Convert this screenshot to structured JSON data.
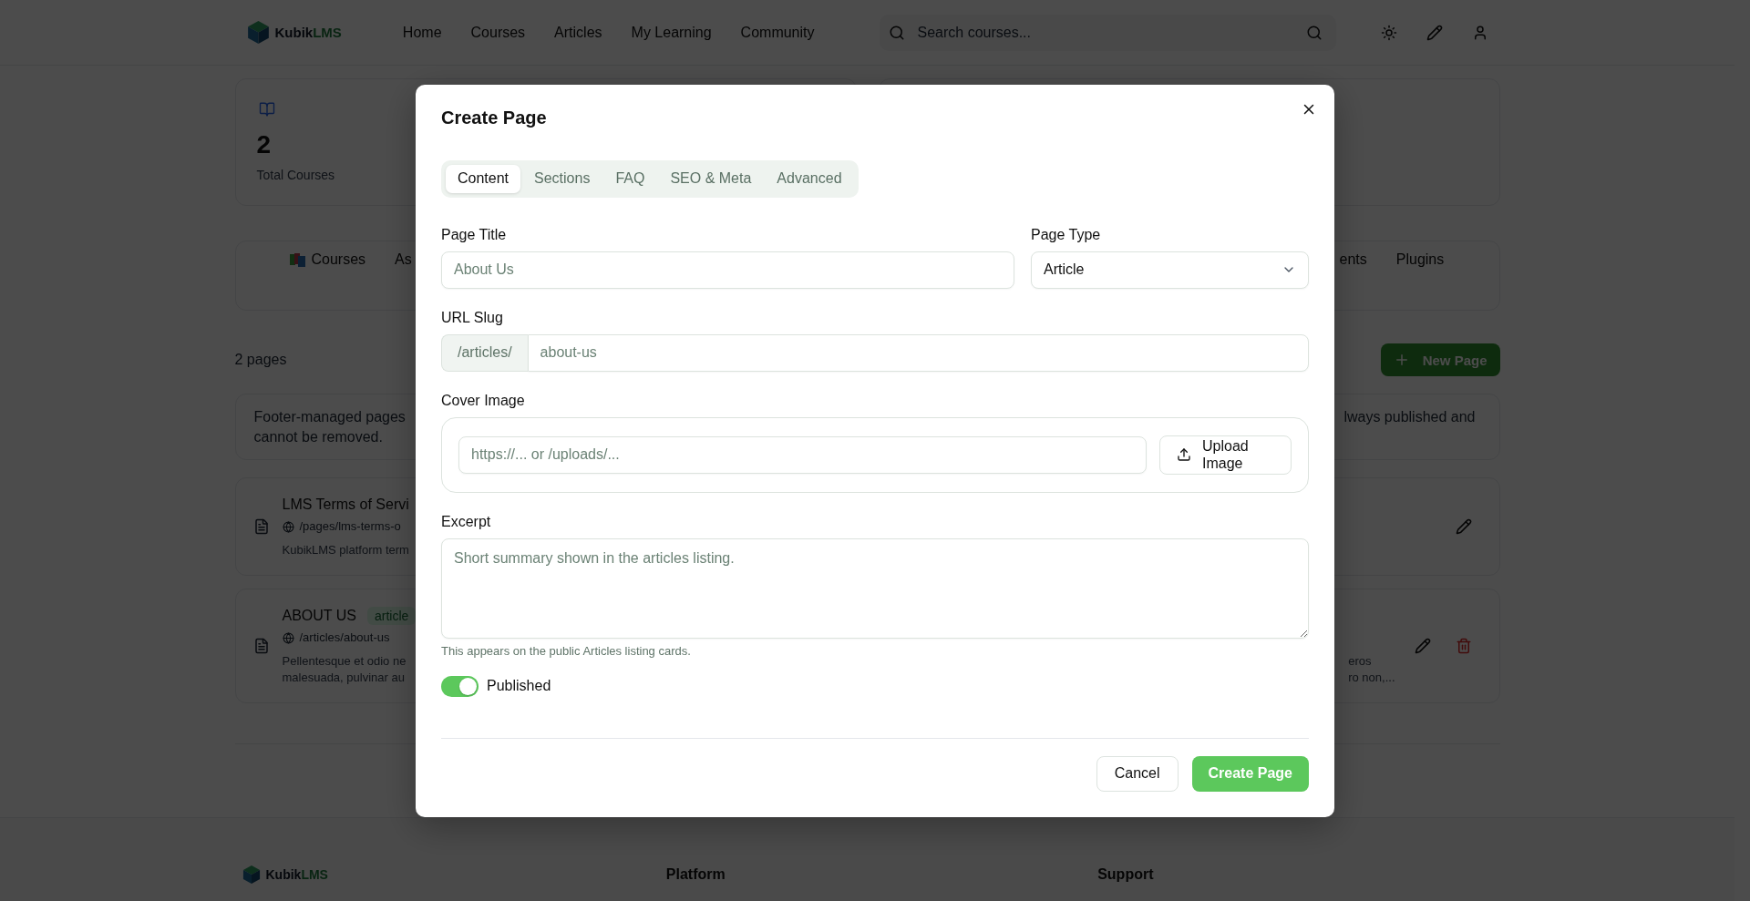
{
  "header": {
    "logo": {
      "name": "Kubik",
      "suffix": "LMS"
    },
    "nav": [
      "Home",
      "Courses",
      "Articles",
      "My Learning",
      "Community"
    ],
    "search": {
      "placeholder": "Search courses..."
    }
  },
  "stats": [
    {
      "value": "2",
      "label": "Total Courses"
    }
  ],
  "section_tabs": {
    "start": [
      {
        "label": "Courses",
        "kind": "icon"
      },
      {
        "label": "As",
        "kind": "plain"
      }
    ],
    "end": [
      {
        "label": "ents"
      },
      {
        "label": "Plugins"
      }
    ]
  },
  "page_count": "2 pages",
  "new_page_button": "New Page",
  "notice": {
    "start_lines": [
      "Footer-managed pages",
      "cannot be removed."
    ],
    "end_lines": [
      "lways published and"
    ]
  },
  "pages": [
    {
      "title": "LMS Terms of Servi",
      "url": "/pages/lms-terms-o",
      "excerpt_start": [
        "KubikLMS platform term"
      ],
      "actions": [
        {
          "kind": "edit"
        }
      ]
    },
    {
      "title": "ABOUT US",
      "badge": "article",
      "url": "/articles/about-us",
      "excerpt_start": [
        "Pellentesque et odio ne",
        "malesuada, pulvinar au"
      ],
      "excerpt_end": [
        "eros",
        "ro non,..."
      ],
      "actions": [
        {
          "kind": "edit"
        },
        {
          "kind": "delete"
        }
      ]
    }
  ],
  "footer": {
    "logo": {
      "name": "Kubik",
      "suffix": "LMS"
    },
    "headings": [
      "Platform",
      "Support"
    ]
  },
  "modal": {
    "title": "Create Page",
    "tabs": [
      {
        "label": "Content",
        "selected": true
      },
      {
        "label": "Sections",
        "selected": false
      },
      {
        "label": "FAQ",
        "selected": false
      },
      {
        "label": "SEO & Meta",
        "selected": false
      },
      {
        "label": "Advanced",
        "selected": false
      }
    ],
    "page_title": {
      "label": "Page Title",
      "placeholder": "About Us"
    },
    "page_type": {
      "label": "Page Type",
      "value": "Article"
    },
    "url_slug": {
      "label": "URL Slug",
      "prefix": "/articles/",
      "placeholder": "about-us"
    },
    "cover_image": {
      "label": "Cover Image",
      "placeholder": "https://... or /uploads/...",
      "button": "Upload Image"
    },
    "excerpt": {
      "label": "Excerpt",
      "placeholder": "Short summary shown in the articles listing.",
      "hint": "This appears on the public Articles listing cards."
    },
    "published": {
      "label": "Published",
      "on": true
    },
    "buttons": {
      "cancel": "Cancel",
      "submit": "Create Page"
    }
  }
}
